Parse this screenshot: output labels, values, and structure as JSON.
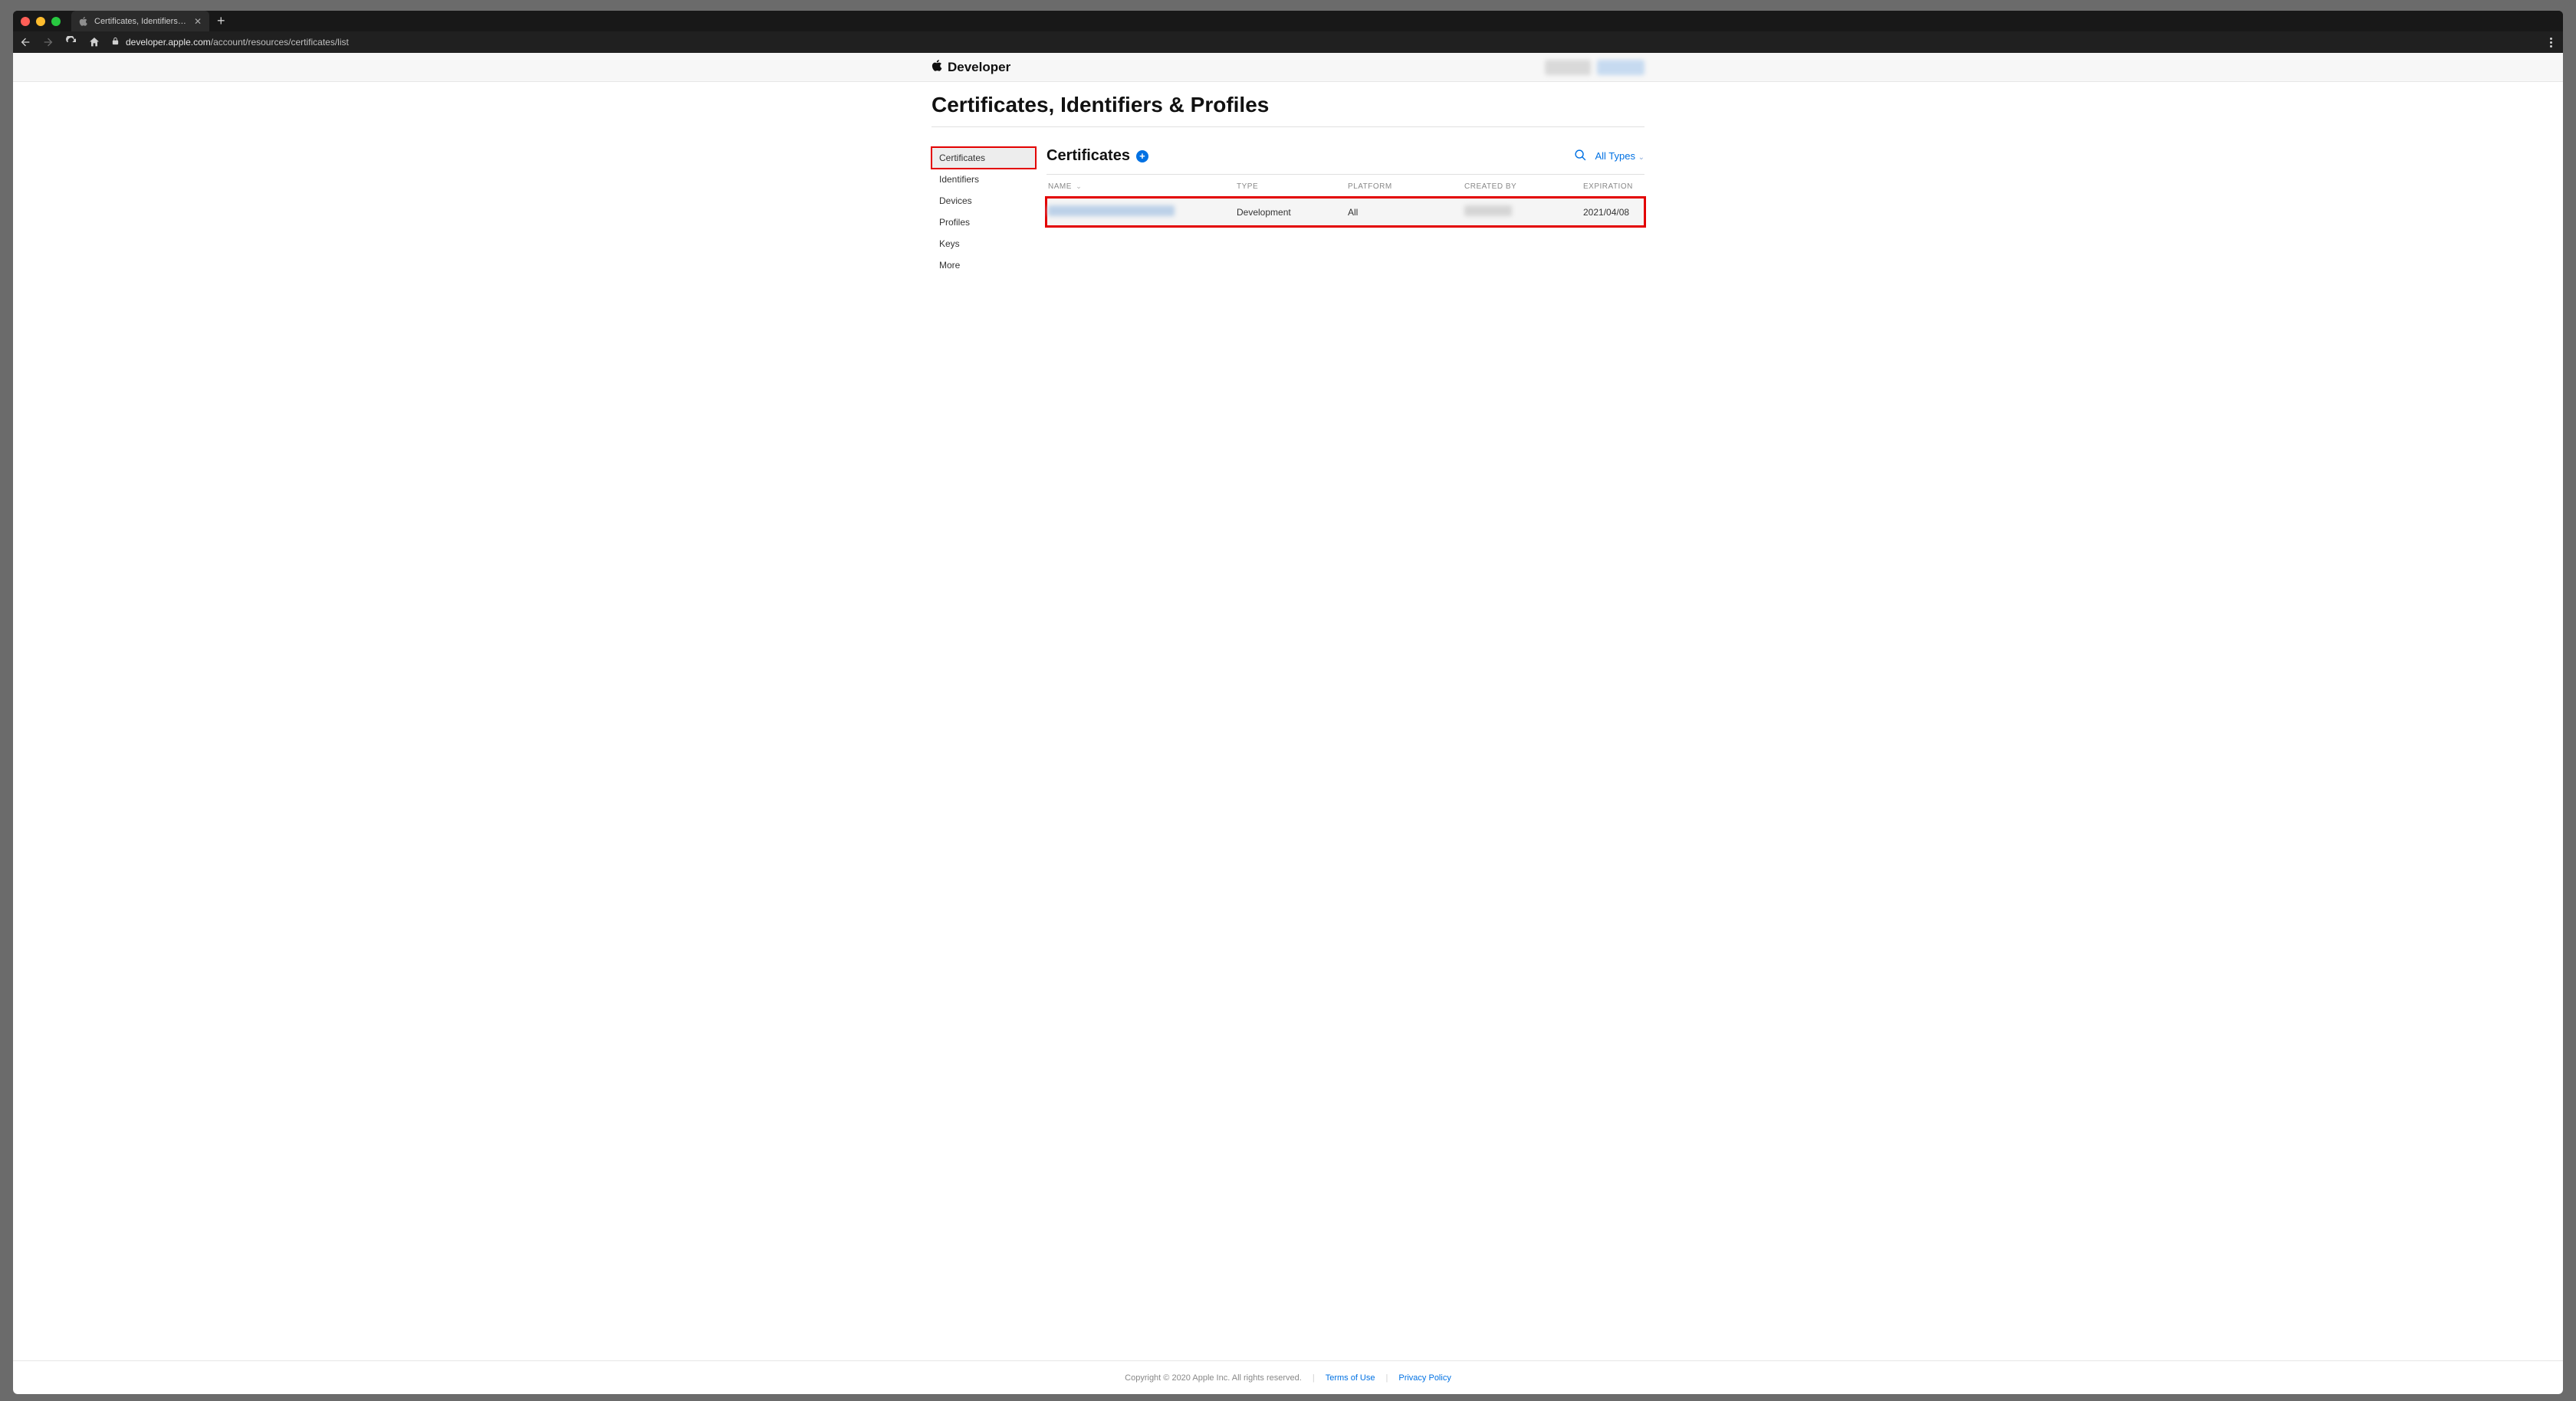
{
  "browser": {
    "tab_title": "Certificates, Identifiers & Profiles",
    "url_host": "developer.apple.com",
    "url_path": "/account/resources/certificates/list"
  },
  "header": {
    "brand": "Developer"
  },
  "page": {
    "title": "Certificates, Identifiers & Profiles"
  },
  "sidebar": {
    "items": [
      {
        "label": "Certificates",
        "active": true
      },
      {
        "label": "Identifiers"
      },
      {
        "label": "Devices"
      },
      {
        "label": "Profiles"
      },
      {
        "label": "Keys"
      },
      {
        "label": "More"
      }
    ]
  },
  "main": {
    "heading": "Certificates",
    "filter_label": "All Types",
    "columns": {
      "name": "NAME",
      "type": "TYPE",
      "platform": "PLATFORM",
      "created_by": "CREATED BY",
      "expiration": "EXPIRATION"
    },
    "rows": [
      {
        "name_redacted": true,
        "type": "Development",
        "platform": "All",
        "created_by_redacted": true,
        "expiration": "2021/04/08"
      }
    ]
  },
  "footer": {
    "copyright": "Copyright © 2020 Apple Inc. All rights reserved.",
    "terms": "Terms of Use",
    "privacy": "Privacy Policy"
  }
}
